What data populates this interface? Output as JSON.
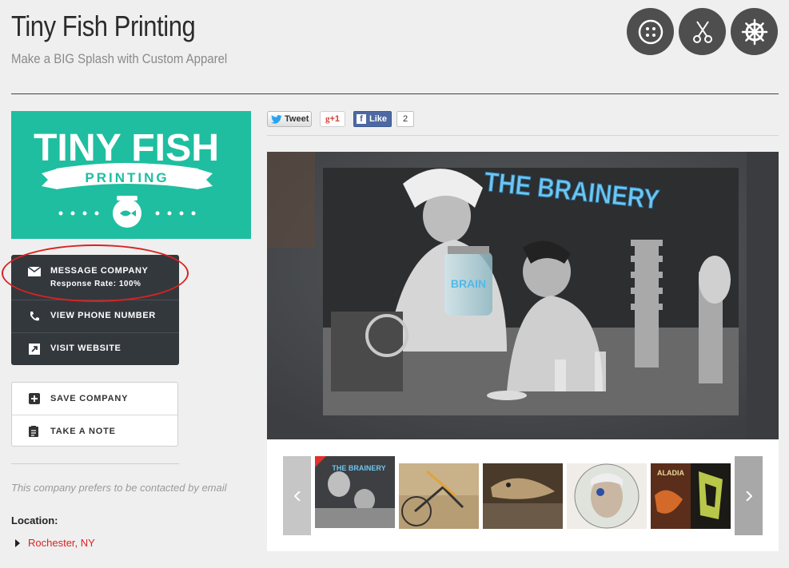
{
  "header": {
    "title": "Tiny Fish Printing",
    "subtitle": "Make a BIG Splash with Custom Apparel",
    "circle_buttons": [
      {
        "icon": "button-icon"
      },
      {
        "icon": "scissors-icon"
      },
      {
        "icon": "ship-wheel-icon"
      }
    ]
  },
  "logo": {
    "line1": "TINY FISH",
    "line2": "PRINTING",
    "bg_color": "#1fbea0"
  },
  "contact_actions": {
    "message": {
      "label": "MESSAGE COMPANY",
      "sub": "Response Rate: 100%"
    },
    "phone": {
      "label": "VIEW PHONE NUMBER"
    },
    "website": {
      "label": "VISIT WEBSITE"
    }
  },
  "secondary_actions": {
    "save": {
      "label": "SAVE COMPANY"
    },
    "note": {
      "label": "TAKE A NOTE"
    }
  },
  "preference_text": "This company prefers to be contacted by email",
  "location": {
    "label": "Location:",
    "city": "Rochester, NY"
  },
  "social": {
    "tweet": "Tweet",
    "gplus": "+1",
    "like": "Like",
    "like_count": "2"
  },
  "main_image": {
    "shirt_text": "THE BRAINERY"
  },
  "gallery": {
    "thumbnails": [
      {
        "name": "thumb-brainery",
        "text": "THE BRAINERY"
      },
      {
        "name": "thumb-bicycle",
        "text": ""
      },
      {
        "name": "thumb-fish",
        "text": ""
      },
      {
        "name": "thumb-franklin",
        "text": ""
      },
      {
        "name": "thumb-palladia",
        "text": "ALADIA"
      }
    ]
  },
  "colors": {
    "accent_red": "#d82320",
    "dark_button": "#33383d",
    "teal": "#1fbea0"
  }
}
